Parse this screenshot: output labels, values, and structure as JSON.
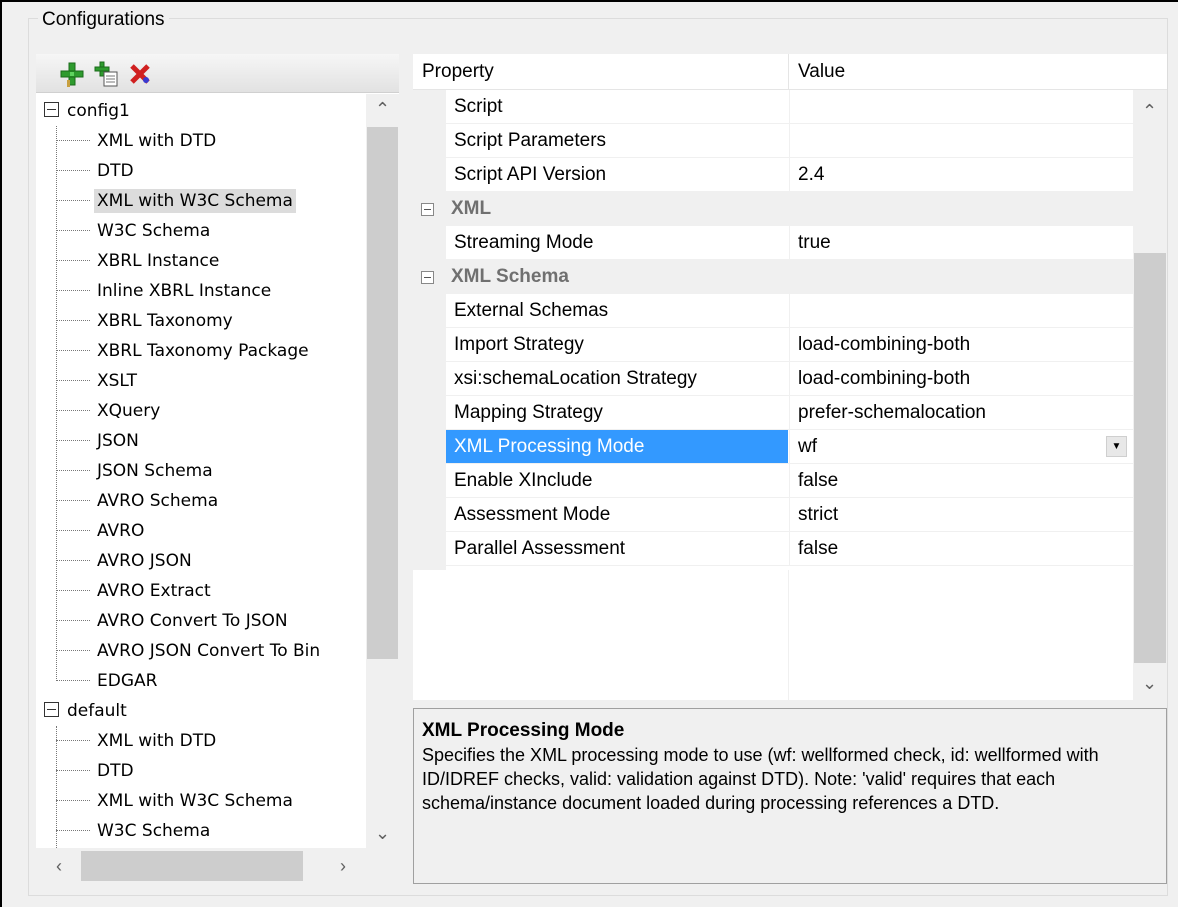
{
  "group_title": "Configurations",
  "toolbar": {
    "add_icon": "add-config-icon",
    "copy_icon": "copy-config-icon",
    "delete_icon": "delete-config-icon"
  },
  "tree": {
    "config1": {
      "label": "config1",
      "items": [
        "XML with DTD",
        "DTD",
        "XML with W3C Schema",
        "W3C Schema",
        "XBRL Instance",
        "Inline XBRL Instance",
        "XBRL Taxonomy",
        "XBRL Taxonomy Package",
        "XSLT",
        "XQuery",
        "JSON",
        "JSON Schema",
        "AVRO Schema",
        "AVRO",
        "AVRO JSON",
        "AVRO Extract",
        "AVRO Convert To JSON",
        "AVRO JSON Convert To Bin",
        "EDGAR"
      ],
      "selected": "XML with W3C Schema"
    },
    "default": {
      "label": "default",
      "items": [
        "XML with DTD",
        "DTD",
        "XML with W3C Schema",
        "W3C Schema"
      ]
    }
  },
  "grid": {
    "header_property": "Property",
    "header_value": "Value",
    "rows": [
      {
        "name": "Script",
        "value": ""
      },
      {
        "name": "Script Parameters",
        "value": ""
      },
      {
        "name": "Script API Version",
        "value": "2.4"
      },
      {
        "category": "XML"
      },
      {
        "name": "Streaming Mode",
        "value": "true"
      },
      {
        "category": "XML Schema"
      },
      {
        "name": "External Schemas",
        "value": ""
      },
      {
        "name": "Import Strategy",
        "value": "load-combining-both"
      },
      {
        "name": "xsi:schemaLocation Strategy",
        "value": "load-combining-both"
      },
      {
        "name": "Mapping Strategy",
        "value": "prefer-schemalocation"
      },
      {
        "name": "XML Processing Mode",
        "value": "wf",
        "selected": true,
        "dropdown": true
      },
      {
        "name": "Enable XInclude",
        "value": "false"
      },
      {
        "name": "Assessment Mode",
        "value": "strict"
      },
      {
        "name": "Parallel Assessment",
        "value": "false"
      }
    ]
  },
  "description": {
    "title": "XML Processing Mode",
    "text": "Specifies the XML processing mode to use (wf: wellformed check, id: wellformed with ID/IDREF checks, valid: validation against DTD). Note: 'valid' requires that each schema/instance document loaded during processing references a DTD."
  },
  "colors": {
    "selection": "#3399ff",
    "tree_selection": "#dcdcdc",
    "category_text": "#707070"
  }
}
